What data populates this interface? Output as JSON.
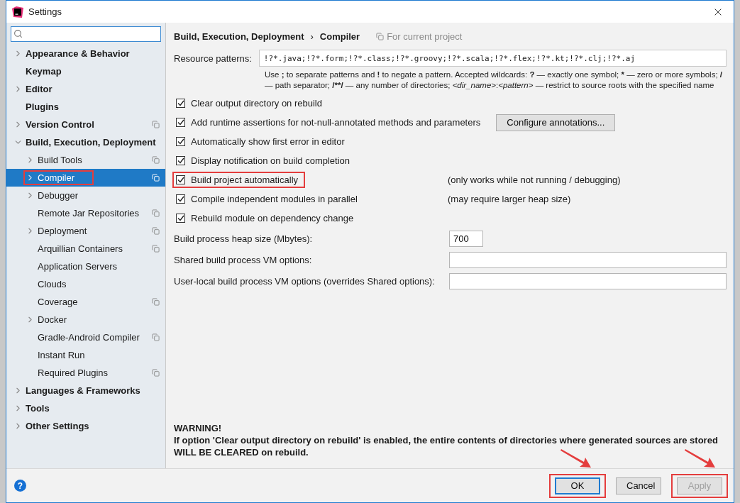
{
  "window": {
    "title": "Settings"
  },
  "sidebar": {
    "items": [
      {
        "label": "Appearance & Behavior",
        "kind": "folder",
        "expanded": false,
        "selected": false,
        "project": false,
        "highlighted": false
      },
      {
        "label": "Keymap",
        "kind": "leaf",
        "selected": false,
        "project": false,
        "highlighted": false
      },
      {
        "label": "Editor",
        "kind": "folder",
        "expanded": false,
        "selected": false,
        "project": false,
        "highlighted": false
      },
      {
        "label": "Plugins",
        "kind": "leaf",
        "selected": false,
        "project": false,
        "highlighted": false
      },
      {
        "label": "Version Control",
        "kind": "folder",
        "expanded": false,
        "selected": false,
        "project": true,
        "highlighted": false
      },
      {
        "label": "Build, Execution, Deployment",
        "kind": "folder",
        "expanded": true,
        "selected": false,
        "project": false,
        "highlighted": false,
        "children": [
          {
            "label": "Build Tools",
            "kind": "folder",
            "expanded": false,
            "selected": false,
            "project": true,
            "highlighted": false
          },
          {
            "label": "Compiler",
            "kind": "folder",
            "expanded": false,
            "selected": true,
            "project": true,
            "highlighted": true
          },
          {
            "label": "Debugger",
            "kind": "folder",
            "expanded": false,
            "selected": false,
            "project": false,
            "highlighted": false
          },
          {
            "label": "Remote Jar Repositories",
            "kind": "leaf",
            "selected": false,
            "project": true,
            "highlighted": false
          },
          {
            "label": "Deployment",
            "kind": "folder",
            "expanded": false,
            "selected": false,
            "project": true,
            "highlighted": false
          },
          {
            "label": "Arquillian Containers",
            "kind": "leaf",
            "selected": false,
            "project": true,
            "highlighted": false
          },
          {
            "label": "Application Servers",
            "kind": "leaf",
            "selected": false,
            "project": false,
            "highlighted": false
          },
          {
            "label": "Clouds",
            "kind": "leaf",
            "selected": false,
            "project": false,
            "highlighted": false
          },
          {
            "label": "Coverage",
            "kind": "leaf",
            "selected": false,
            "project": true,
            "highlighted": false
          },
          {
            "label": "Docker",
            "kind": "folder",
            "expanded": false,
            "selected": false,
            "project": false,
            "highlighted": false
          },
          {
            "label": "Gradle-Android Compiler",
            "kind": "leaf",
            "selected": false,
            "project": true,
            "highlighted": false
          },
          {
            "label": "Instant Run",
            "kind": "leaf",
            "selected": false,
            "project": false,
            "highlighted": false
          },
          {
            "label": "Required Plugins",
            "kind": "leaf",
            "selected": false,
            "project": true,
            "highlighted": false
          }
        ]
      },
      {
        "label": "Languages & Frameworks",
        "kind": "folder",
        "expanded": false,
        "selected": false,
        "project": false,
        "highlighted": false
      },
      {
        "label": "Tools",
        "kind": "folder",
        "expanded": false,
        "selected": false,
        "project": false,
        "highlighted": false
      },
      {
        "label": "Other Settings",
        "kind": "folder",
        "expanded": false,
        "selected": false,
        "project": false,
        "highlighted": false
      }
    ]
  },
  "breadcrumb": {
    "parent": "Build, Execution, Deployment",
    "separator": "›",
    "current": "Compiler",
    "scope": "For current project"
  },
  "resource_patterns": {
    "label": "Resource patterns:",
    "value": "!?*.java;!?*.form;!?*.class;!?*.groovy;!?*.scala;!?*.flex;!?*.kt;!?*.clj;!?*.aj",
    "help": [
      {
        "text": "Use ",
        "kind": "plain"
      },
      {
        "text": ";",
        "kind": "bold"
      },
      {
        "text": " to separate patterns and ",
        "kind": "plain"
      },
      {
        "text": "!",
        "kind": "bold"
      },
      {
        "text": " to negate a pattern. Accepted wildcards: ",
        "kind": "plain"
      },
      {
        "text": "?",
        "kind": "bold"
      },
      {
        "text": " — exactly one symbol; ",
        "kind": "plain"
      },
      {
        "text": "*",
        "kind": "bold"
      },
      {
        "text": " — zero or more symbols; ",
        "kind": "plain"
      },
      {
        "text": "/",
        "kind": "bold"
      },
      {
        "text": " — path separator; ",
        "kind": "plain"
      },
      {
        "text": "/**/",
        "kind": "bold"
      },
      {
        "text": " — any number of directories; ",
        "kind": "plain"
      },
      {
        "text": "<dir_name>",
        "kind": "italic"
      },
      {
        "text": ":",
        "kind": "plain"
      },
      {
        "text": "<pattern>",
        "kind": "italic"
      },
      {
        "text": " — restrict to source roots with the specified name",
        "kind": "plain"
      }
    ]
  },
  "options": [
    {
      "label": "Clear output directory on rebuild",
      "checked": true,
      "highlighted": false
    },
    {
      "label": "Add runtime assertions for not-null-annotated methods and parameters",
      "checked": true,
      "highlighted": false,
      "button": "Configure annotations..."
    },
    {
      "label": "Automatically show first error in editor",
      "checked": true,
      "highlighted": false
    },
    {
      "label": "Display notification on build completion",
      "checked": true,
      "highlighted": false
    },
    {
      "label": "Build project automatically",
      "checked": true,
      "highlighted": true,
      "note": "(only works while not running / debugging)"
    },
    {
      "label": "Compile independent modules in parallel",
      "checked": true,
      "highlighted": false,
      "note": "(may require larger heap size)"
    },
    {
      "label": "Rebuild module on dependency change",
      "checked": true,
      "highlighted": false
    }
  ],
  "fields": [
    {
      "label": "Build process heap size (Mbytes):",
      "value": "700",
      "kind": "short"
    },
    {
      "label": "Shared build process VM options:",
      "kind": "wide"
    },
    {
      "label": "User-local build process VM options (overrides Shared options):",
      "kind": "wide"
    }
  ],
  "warning": {
    "title": "WARNING!",
    "text": "If option 'Clear output directory on rebuild' is enabled, the entire contents of directories where generated sources are stored WILL BE CLEARED on rebuild."
  },
  "footer": {
    "help": "?",
    "buttons": [
      {
        "label": "OK",
        "default": true,
        "disabled": false,
        "highlighted": true
      },
      {
        "label": "Cancel",
        "default": false,
        "disabled": false,
        "highlighted": false
      },
      {
        "label": "Apply",
        "default": false,
        "disabled": true,
        "highlighted": true
      }
    ]
  }
}
